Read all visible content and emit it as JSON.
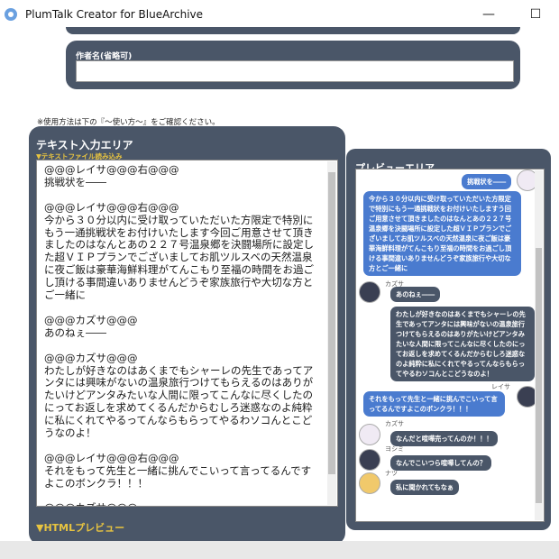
{
  "window": {
    "title": "PlumTalk Creator for BlueArchive"
  },
  "author": {
    "label": "作者名(省略可)",
    "value": ""
  },
  "notice": "※使用方法は下の『～使い方～』をご確認ください。",
  "text_area": {
    "title": "テキスト入力エリア",
    "file_link": "▼テキストファイル読み込み",
    "content": "@@@レイサ@@@右@@@\n挑戦状を――\n\n@@@レイサ@@@右@@@\n今から３０分以内に受け取っていただいた方限定で特別にもう一通挑戦状をお付けいたします今回ご用意させて頂きましたのはなんとあの２２７号温泉郷を決闘場所に設定した超ＶＩＰプランでございましてお肌ツルスベの天然温泉に夜ご飯は豪華海鮮料理がてんこもり至福の時間をお過ごし頂ける事間違いありませんどうぞ家族旅行や大切な方とご一緒に\n\n@@@カズサ@@@\nあのねぇ――\n\n@@@カズサ@@@\nわたしが好きなのはあくまでもシャーレの先生であってアンタには興味がないの温泉旅行つけてもらえるのはありがたいけどアンタみたいな人間に限ってこんなに尽くしたのにってお返しを求めてくるんだからむしろ迷惑なのよ純粋に私にくれてやるってんならもらってやるわソコんとこどうなのよ！\n\n@@@レイサ@@@右@@@\nそれをもって先生と一緒に挑んでこいって言ってるんですよこのボンクラ！！！\n\n@@@カズサ@@@\nなんだと喧嘩売ってんのか！！！\n\n@@@ヨシミ@@@\nなんでこいつら喧嘩してんの？",
    "html_preview": "▼HTMLプレビュー"
  },
  "preview": {
    "title": "プレビューエリア",
    "messages": [
      {
        "side": "right",
        "name": "",
        "text": "挑戦状を――"
      },
      {
        "side": "right",
        "name": "",
        "text": "今から３０分以内に受け取っていただいた方限定で特別にもう一通挑戦状をお付けいたしますう回ご用意させて頂きましたのはなんとあの２２７号温泉郷を決闘場所に設定した超ＶＩＰプランでございましてお肌ツルスベの天然温泉に夜ご飯は豪華海鮮料理がてんこもり至福の時間をお過ごし頂ける事間違いありませんどうぞ家族旅行や大切な方とご一緒に"
      },
      {
        "side": "left",
        "name": "カズサ",
        "text": "あのねぇ――"
      },
      {
        "side": "left",
        "name": "",
        "text": "わたしが好きなのはあくまでもシャーレの先生であってアンタには興味がないの温泉旅行つけてもらえるのはありがたいけどアンタみたいな人間に限ってこんなに尽くしたのにってお返しを求めてくるんだからむしろ迷惑なのよ純粋に私にくれてやるってんならもらってやるわソコんとこどうなのよ！"
      },
      {
        "side": "right",
        "name": "レイサ",
        "text": "それをもって先生と一緒に挑んでこいって言ってるんですよこのボンクラ！！！"
      },
      {
        "side": "left",
        "name": "カズサ",
        "text": "なんだと喧嘩売ってんのか！！！"
      },
      {
        "side": "left",
        "name": "ヨシミ",
        "text": "なんでこいつら喧嘩してんの？"
      },
      {
        "side": "left",
        "name": "ナツ",
        "text": "私に聞かれてもなぁ"
      }
    ]
  },
  "colors": {
    "panel": "#4a5668",
    "accent_yellow": "#e8c440",
    "bubble_blue": "#4a7bcf"
  }
}
